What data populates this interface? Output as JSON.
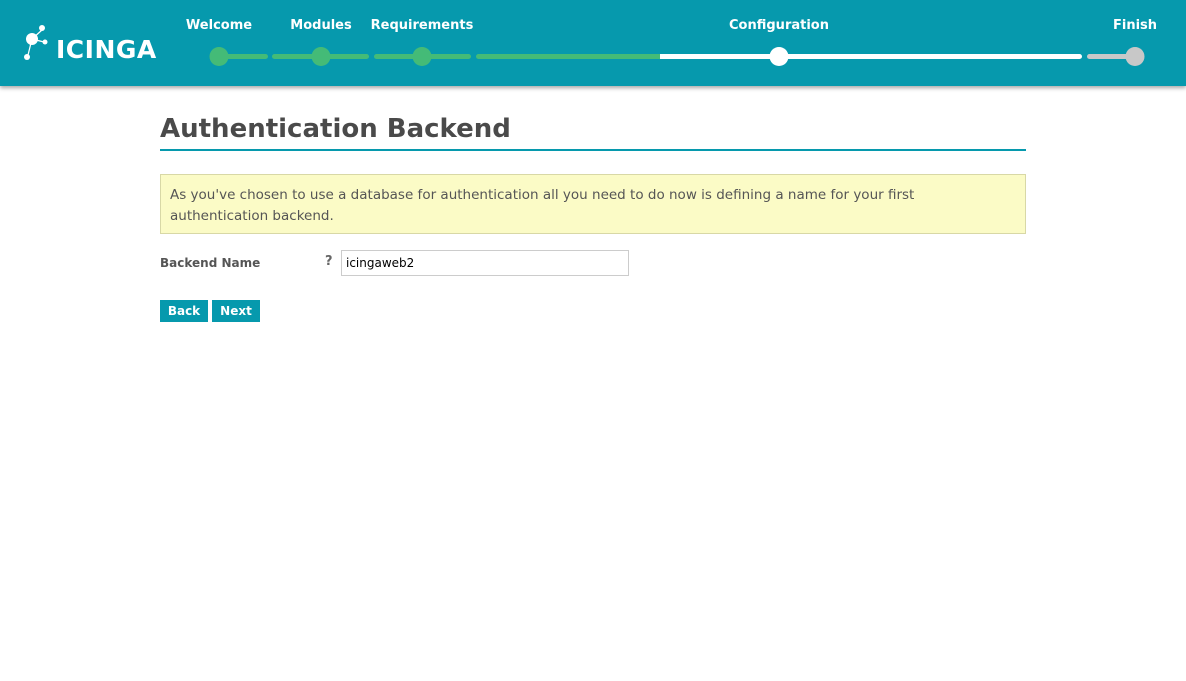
{
  "colors": {
    "brand": "#0699ad",
    "step_done": "#44bb77",
    "step_current": "#ffffff",
    "step_pending": "#c8c8c8"
  },
  "logo": {
    "text": "ICINGA"
  },
  "wizard": {
    "steps": [
      {
        "label": "Welcome",
        "state": "done"
      },
      {
        "label": "Modules",
        "state": "done"
      },
      {
        "label": "Requirements",
        "state": "done"
      },
      {
        "label": "",
        "state": "done"
      },
      {
        "label": "Configuration",
        "state": "current"
      },
      {
        "label": "Finish",
        "state": "pending"
      }
    ]
  },
  "page": {
    "title": "Authentication Backend",
    "notice": "As you've chosen to use a database for authentication all you need to do now is defining a name for your first authentication backend."
  },
  "form": {
    "backend_name_label": "Backend Name",
    "help_icon": "question-icon",
    "backend_name_value": "icingaweb2"
  },
  "buttons": {
    "back_label": "Back",
    "next_label": "Next"
  }
}
